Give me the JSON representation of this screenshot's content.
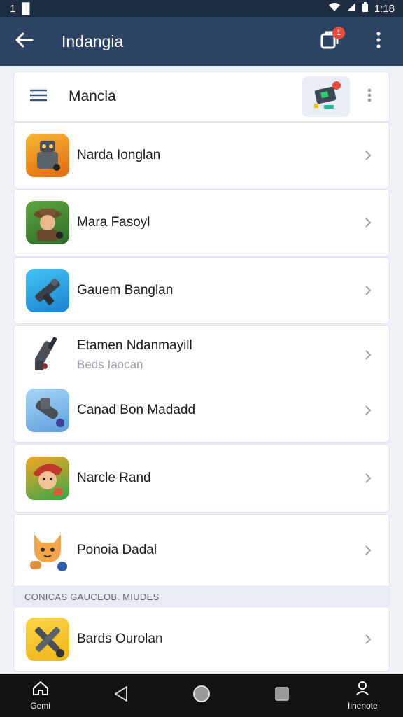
{
  "status_bar": {
    "left_text": "1 ▐▌",
    "time": "1:18"
  },
  "app_bar": {
    "title": "Indangia",
    "notification_count": "1"
  },
  "header": {
    "title": "Mancla"
  },
  "items": [
    {
      "name": "Narda Ionglan",
      "icon": "robot-icon",
      "color": "#f39c12"
    },
    {
      "name": "Mara Fasoyl",
      "icon": "explorer-icon",
      "color": "#3f8a3a"
    },
    {
      "name": "Gauem Banglan",
      "icon": "blaster-icon",
      "color": "#2ea6e0"
    },
    {
      "name": "Etamen Ndanmayill",
      "sub": "Beds Iaocan",
      "icon": "gun-icon",
      "color": "#ffffff"
    },
    {
      "name": "Canad Bon Madadd",
      "icon": "cannon-icon",
      "color": "#5ba3e0"
    },
    {
      "name": "Narcle Rand",
      "icon": "hero-icon",
      "color": "#e84c3d"
    },
    {
      "name": "Ponoia Dadal",
      "icon": "cat-icon",
      "color": "#ffffff"
    }
  ],
  "section": {
    "label": "CONICAS GAUCEOB. MIUDES"
  },
  "items2": [
    {
      "name": "Bards Ourolan",
      "icon": "crossed-guns-icon",
      "color": "#f5c21a"
    }
  ],
  "nav": {
    "home_label": "Gemi",
    "profile_label": "Iinenote"
  }
}
